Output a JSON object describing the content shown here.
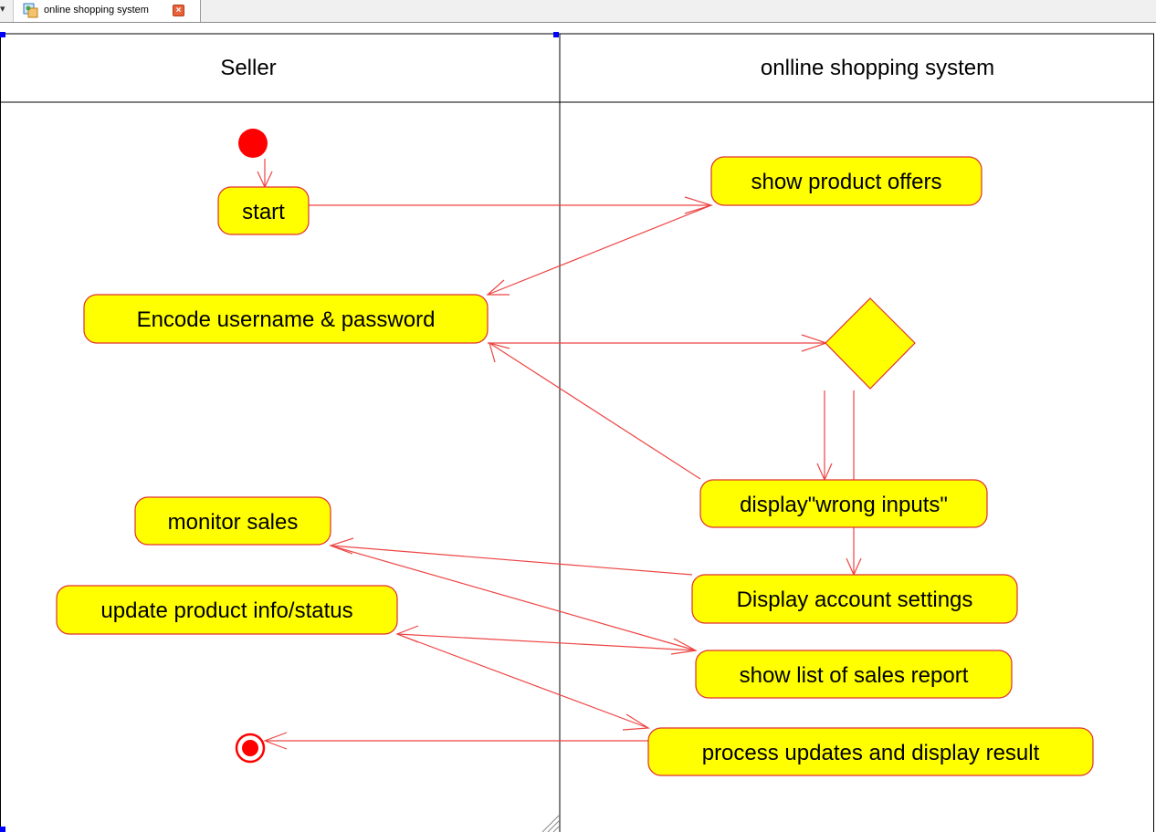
{
  "tab": {
    "title": "online shopping system",
    "close_glyph": "×",
    "icon": "diagram-icon"
  },
  "swimlanes": [
    {
      "id": "seller",
      "label": "Seller"
    },
    {
      "id": "system",
      "label": "onlline shopping system"
    }
  ],
  "nodes": {
    "start": "start",
    "show_product_offers": "show product offers",
    "encode_credentials": "Encode username & password",
    "display_wrong_inputs": "display\"wrong inputs\"",
    "monitor_sales": "monitor sales",
    "display_account_settings": "Display account settings",
    "update_product_info": "update product info/status",
    "show_sales_report": "show list of sales report",
    "process_updates": "process updates and display result"
  },
  "colors": {
    "node_fill": "#ffff00",
    "node_stroke": "#e03030",
    "edge": "#ee4444",
    "initial": "#ff0000",
    "lane_line": "#000000"
  }
}
